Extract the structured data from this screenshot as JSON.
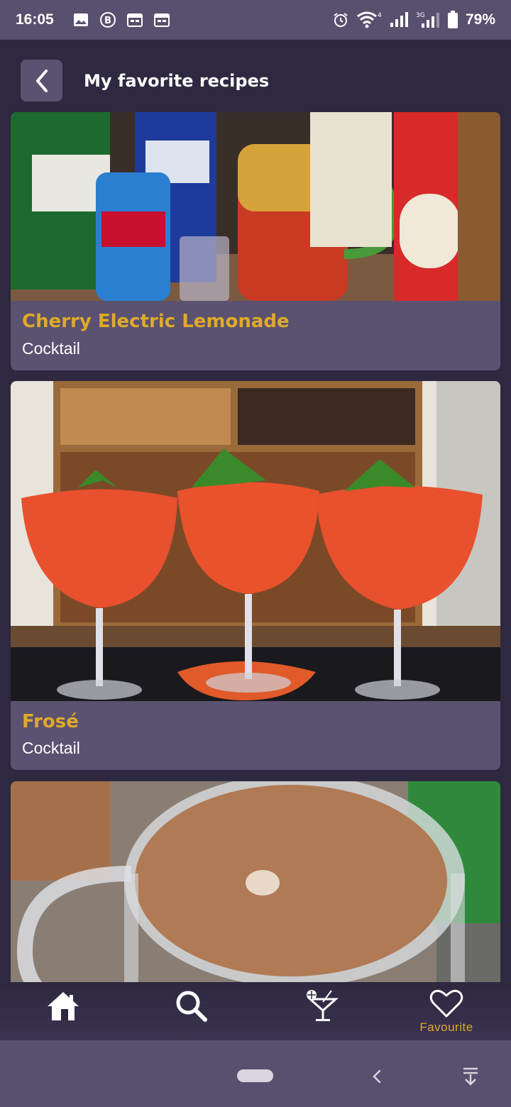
{
  "status_bar": {
    "time": "16:05",
    "left_icons": [
      "gallery-icon",
      "bitcoin-icon",
      "calendar-icon",
      "calendar-icon"
    ],
    "right_icons": [
      "alarm-icon",
      "wifi-icon",
      "signal-4g-icon",
      "signal-3g-icon",
      "battery-icon"
    ],
    "net_4g": "4G",
    "net_3g": "3G",
    "battery": "79%"
  },
  "header": {
    "title": "My favorite recipes",
    "back_icon": "chevron-left-icon"
  },
  "recipes": [
    {
      "name": "Cherry Electric Lemonade",
      "category": "Cocktail"
    },
    {
      "name": "Frosé",
      "category": "Cocktail"
    },
    {
      "name": "",
      "category": ""
    }
  ],
  "bottom_nav": {
    "items": [
      {
        "icon": "home-icon",
        "label": ""
      },
      {
        "icon": "search-icon",
        "label": ""
      },
      {
        "icon": "cocktail-icon",
        "label": ""
      },
      {
        "icon": "heart-icon",
        "label": "Favourite"
      }
    ],
    "active_color": "#e0a92a"
  },
  "colors": {
    "background": "#2e2840",
    "card": "#5a5270",
    "accent": "#e0a92a"
  }
}
